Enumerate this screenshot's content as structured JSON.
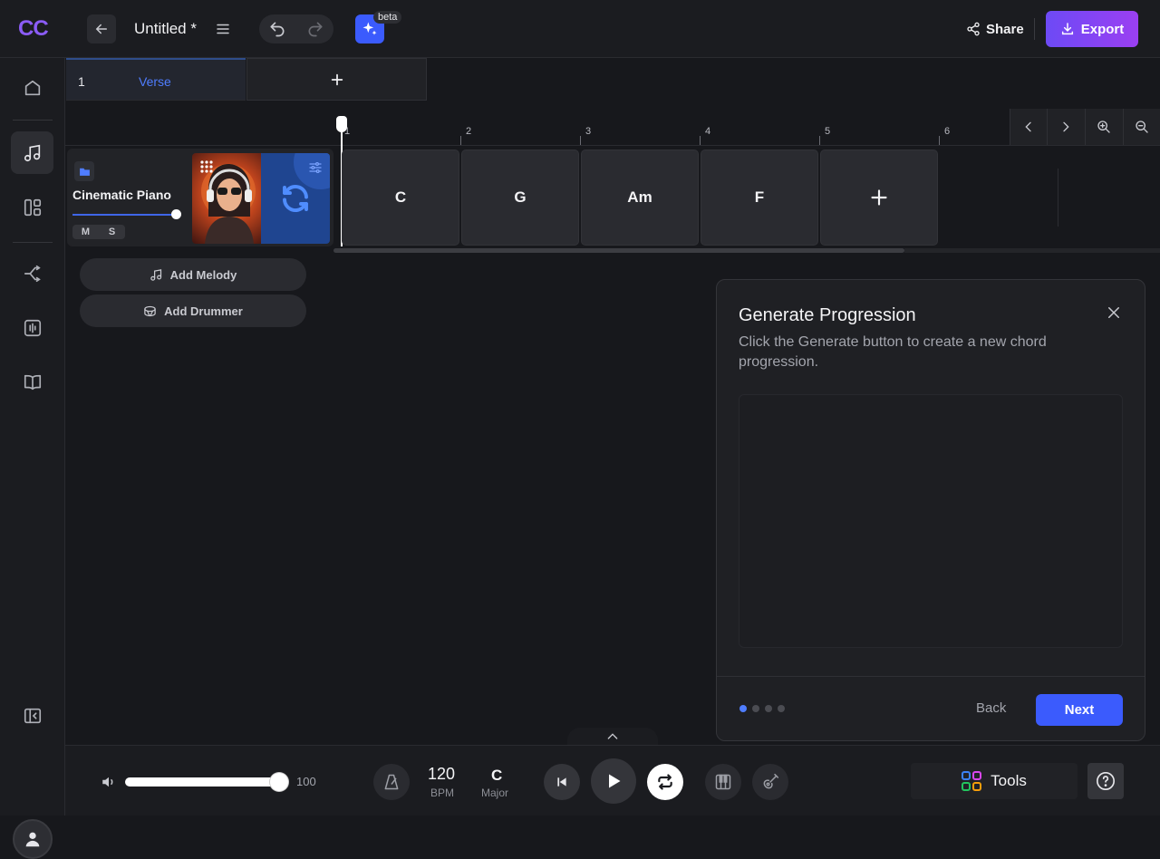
{
  "app": {
    "logo": "CC",
    "title": "Untitled *",
    "beta_badge": "beta",
    "share_label": "Share",
    "export_label": "Export"
  },
  "sidebar": {
    "items": [
      {
        "name": "home-icon"
      },
      {
        "name": "music-note-icon",
        "active": true
      },
      {
        "name": "layout-icon"
      },
      {
        "name": "branch-icon"
      },
      {
        "name": "audio-wave-icon"
      },
      {
        "name": "book-icon"
      },
      {
        "name": "collapse-sidebar-icon"
      }
    ]
  },
  "sections": {
    "items": [
      {
        "number": "1",
        "name": "Verse"
      }
    ],
    "add_label": "+"
  },
  "timeline": {
    "bars": [
      "1",
      "2",
      "3",
      "4",
      "5",
      "6"
    ]
  },
  "track": {
    "name": "Cinematic Piano",
    "mute_label": "M",
    "solo_label": "S",
    "volume_fraction": 1.0
  },
  "chords": [
    "C",
    "G",
    "Am",
    "F"
  ],
  "add_chord_label": "+",
  "add_buttons": {
    "melody": "Add Melody",
    "drummer": "Add Drummer"
  },
  "modal": {
    "title": "Generate Progression",
    "description": "Click the Generate button to create a new chord progression.",
    "back_label": "Back",
    "next_label": "Next",
    "steps_total": 4,
    "current_step": 1
  },
  "transport": {
    "master_volume": "100",
    "bpm_value": "120",
    "bpm_label": "BPM",
    "key_value": "C",
    "key_label": "Major",
    "tools_label": "Tools"
  },
  "colors": {
    "accent_blue": "#3b5bfd",
    "accent_purple": "#8b5cf6",
    "background": "#17181c"
  }
}
